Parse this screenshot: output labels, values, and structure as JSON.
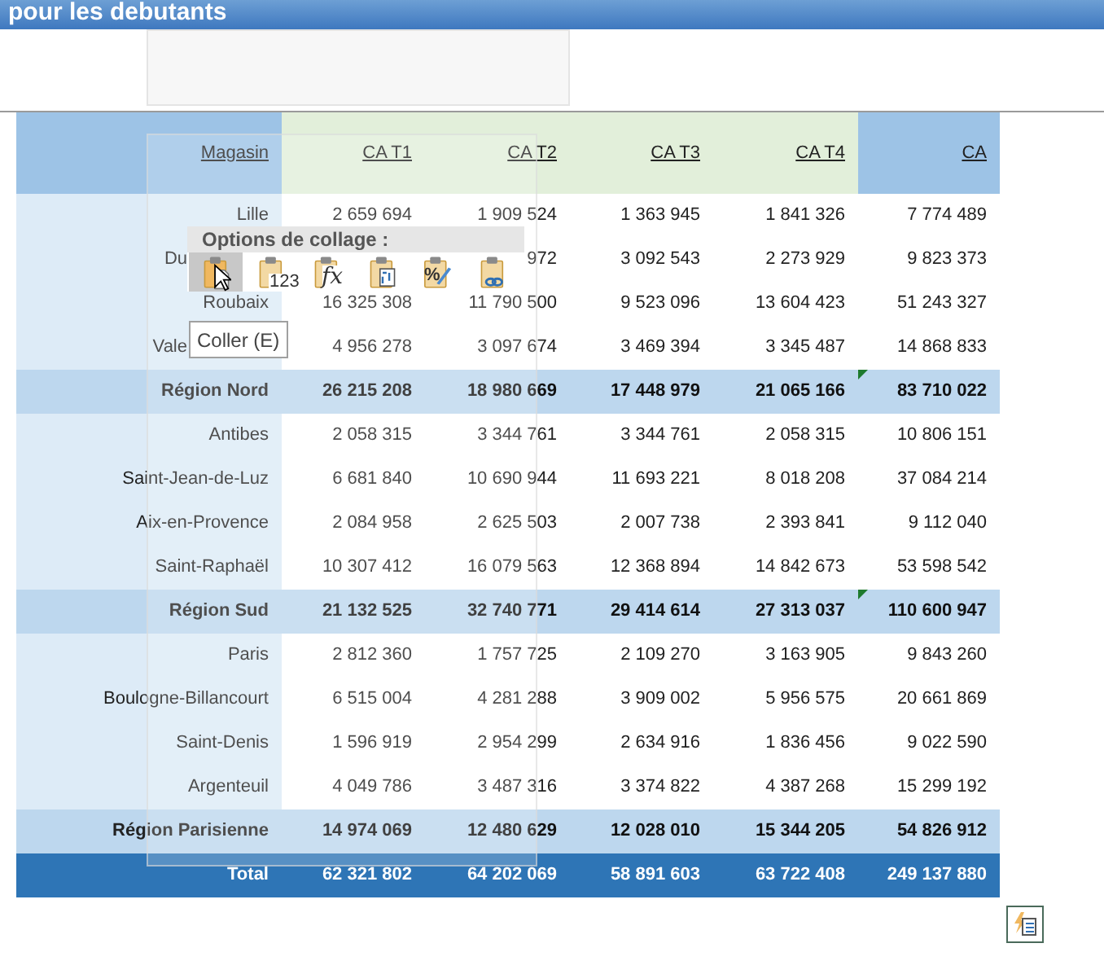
{
  "title_bar": {
    "title": "pour les debutants"
  },
  "table": {
    "columns": [
      {
        "label": "Magasin"
      },
      {
        "label": "CA T1"
      },
      {
        "label": "CA T2"
      },
      {
        "label": "CA T3"
      },
      {
        "label": "CA T4"
      },
      {
        "label": "CA"
      }
    ],
    "rows": [
      {
        "kind": "store",
        "cells": [
          "Lille",
          "2 659 694",
          "1 909 524",
          "1 363 945",
          "1 841 326",
          "7 774 489"
        ]
      },
      {
        "kind": "store",
        "cells": [
          "Du",
          null,
          "972",
          "3 092 543",
          "2 273 929",
          "9 823 373"
        ]
      },
      {
        "kind": "store",
        "cells": [
          "Roubaix",
          "16 325 308",
          "11 790 500",
          "9 523 096",
          "13 604 423",
          "51 243 327"
        ]
      },
      {
        "kind": "store",
        "cells": [
          "Vale",
          "4 956 278",
          "3 097 674",
          "3 469 394",
          "3 345 487",
          "14 868 833"
        ]
      },
      {
        "kind": "region",
        "flag": true,
        "cells": [
          "Région Nord",
          "26 215 208",
          "18 980 669",
          "17 448 979",
          "21 065 166",
          "83 710 022"
        ]
      },
      {
        "kind": "store",
        "cells": [
          "Antibes",
          "2 058 315",
          "3 344 761",
          "3 344 761",
          "2 058 315",
          "10 806 151"
        ]
      },
      {
        "kind": "store",
        "cells": [
          "Saint-Jean-de-Luz",
          "6 681 840",
          "10 690 944",
          "11 693 221",
          "8 018 208",
          "37 084 214"
        ]
      },
      {
        "kind": "store",
        "cells": [
          "Aix-en-Provence",
          "2 084 958",
          "2 625 503",
          "2 007 738",
          "2 393 841",
          "9 112 040"
        ]
      },
      {
        "kind": "store",
        "cells": [
          "Saint-Raphaël",
          "10 307 412",
          "16 079 563",
          "12 368 894",
          "14 842 673",
          "53 598 542"
        ]
      },
      {
        "kind": "region",
        "flag": true,
        "cells": [
          "Région Sud",
          "21 132 525",
          "32 740 771",
          "29 414 614",
          "27 313 037",
          "110 600 947"
        ]
      },
      {
        "kind": "store",
        "cells": [
          "Paris",
          "2 812 360",
          "1 757 725",
          "2 109 270",
          "3 163 905",
          "9 843 260"
        ]
      },
      {
        "kind": "store",
        "cells": [
          "Boulogne-Billancourt",
          "6 515 004",
          "4 281 288",
          "3 909 002",
          "5 956 575",
          "20 661 869"
        ]
      },
      {
        "kind": "store",
        "cells": [
          "Saint-Denis",
          "1 596 919",
          "2 954 299",
          "2 634 916",
          "1 836 456",
          "9 022 590"
        ]
      },
      {
        "kind": "store",
        "cells": [
          "Argenteuil",
          "4 049 786",
          "3 487 316",
          "3 374 822",
          "4 387 268",
          "15 299 192"
        ]
      },
      {
        "kind": "region",
        "flag": false,
        "cells": [
          "Région Parisienne",
          "14 974 069",
          "12 480 629",
          "12 028 010",
          "15 344 205",
          "54 826 912"
        ]
      },
      {
        "kind": "total",
        "cells": [
          "Total",
          "62 321 802",
          "64 202 069",
          "58 891 603",
          "63 722 408",
          "249 137 880"
        ]
      }
    ]
  },
  "paste_options": {
    "title": "Options de collage :",
    "tooltip": "Coller (E)",
    "buttons": [
      {
        "kind": "paste",
        "selected": true
      },
      {
        "kind": "values",
        "label": "123",
        "selected": false
      },
      {
        "kind": "formulas",
        "label": "fx",
        "selected": false
      },
      {
        "kind": "transpose",
        "selected": false
      },
      {
        "kind": "formatting",
        "label": "%",
        "selected": false
      },
      {
        "kind": "link",
        "selected": false
      }
    ]
  }
}
